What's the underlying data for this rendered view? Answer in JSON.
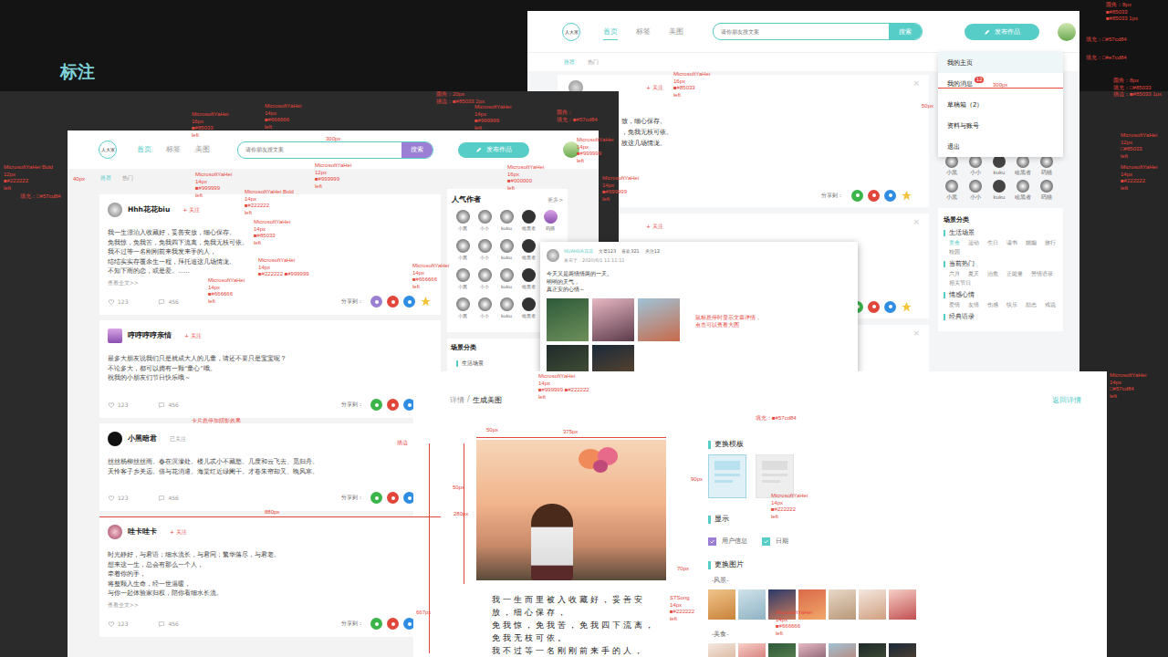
{
  "page_label": "标注",
  "back_window": {
    "logo": "人大家",
    "nav": [
      {
        "label": "首页",
        "selected": true
      },
      {
        "label": "标签",
        "selected": false
      },
      {
        "label": "美图",
        "selected": false
      }
    ],
    "search": {
      "placeholder": "请你朋友搜文案",
      "button": "搜索"
    },
    "publish": "发布作品",
    "subnav": [
      {
        "label": "推荐",
        "selected": true
      },
      {
        "label": "热门",
        "selected": false
      }
    ],
    "posts": [
      {
        "follow": "+ 关注",
        "close": "×",
        "lines": [
          "致，细心保存。",
          "，免我无枝可依。",
          "故这几场情泷。"
        ],
        "share_label": "分享到："
      },
      {
        "follow": "+ 关注",
        "close": "×"
      },
      {
        "close": "×"
      }
    ],
    "menu": [
      {
        "label": "我的主页",
        "selected": true
      },
      {
        "label": "我的消息",
        "badge": "12",
        "selected": false
      },
      {
        "label": "草稿箱（2）",
        "selected": false
      },
      {
        "label": "资料与账号",
        "selected": false
      },
      {
        "label": "退出",
        "selected": false
      }
    ],
    "authors": [
      "小黑",
      "小小",
      "kuku",
      "啥黑者",
      "码猫",
      "小黑",
      "小小",
      "kuku",
      "啥黑者",
      "码猫"
    ],
    "scenes": {
      "title": "场景分类",
      "groups": [
        {
          "name": "生活场景",
          "tags": [
            "美食",
            "运动",
            "生日",
            "读书",
            "婚姻",
            "旅行",
            "校园"
          ]
        },
        {
          "name": "当前热门",
          "tags": [
            "六月",
            "夏天",
            "治愈",
            "正能量",
            "苦情语录",
            "相关节日"
          ]
        },
        {
          "name": "情感心情",
          "tags": [
            "爱情",
            "友情",
            "伤感",
            "快乐",
            "励志",
            "戏说"
          ]
        },
        {
          "name": "经典语录",
          "tags": []
        }
      ]
    }
  },
  "feed_window": {
    "logo": "人大家",
    "nav": [
      {
        "label": "首页",
        "selected": true
      },
      {
        "label": "标签",
        "selected": false
      },
      {
        "label": "美图",
        "selected": false
      }
    ],
    "search": {
      "placeholder": "请你朋友搜文案",
      "button": "搜索"
    },
    "publish": "发布作品",
    "subnav": [
      {
        "label": "推荐",
        "selected": true
      },
      {
        "label": "热门",
        "selected": false
      }
    ],
    "posts": [
      {
        "author": "Hhh花花biu",
        "follow": "+ 关注",
        "followed": false,
        "lines": [
          "我一生漂泊入收藏好，妥善安放，细心保存。",
          "免我惊，免我苦，免我四下流离，免我无枝可依。",
          "我不过等一名刚刚前来我发来手的人，",
          "结结实实存覆余生一程，拜托追这几场情泷。",
          "不知下雨的恋，或是爱。……"
        ],
        "more": "查看全文>>",
        "likes": "123",
        "comments": "456",
        "share_label": "分享到："
      },
      {
        "author": "哼哼哼哼亲情",
        "follow": "+ 关注",
        "followed": false,
        "lines": [
          "最多大朋友说我们只是就成大人的儿童，请还不要只是宝宝呢？",
          "不论多大，都可以拥有一颗“童心”哦。",
          "祝我的小朋友们节日快乐哦～"
        ],
        "likes": "123",
        "comments": "456",
        "share_label": "分享到："
      },
      {
        "author": "小黑暗君",
        "follow": "已关注",
        "followed": true,
        "lines": [
          "丝丝杨柳丝丝雨。春在溟濛处。楼儿忒小不藏愁。几度和云飞去、觅归舟。",
          "天怜客子乡关远。借与花消遣。海棠红近绿阑干。才卷朱帘却又、晚风寒。"
        ],
        "likes": "123",
        "comments": "456",
        "share_label": "分享到："
      },
      {
        "author": "哇卡哇卡",
        "follow": "+ 关注",
        "followed": false,
        "lines": [
          "时光静好，与君语；细水流长，与君同；繁华落尽，与君老。",
          "想来这一生，总会有那么一个人，",
          "牵着你的手，",
          "将整颗入生命，经一世温暖，",
          "与你一起体验家归权，陪你看细水长流。"
        ],
        "more": "查看全文>>",
        "likes": "123",
        "comments": "456",
        "share_label": "分享到："
      }
    ],
    "authors_title": "人气作者",
    "authors_more": "更多>",
    "author_rows": [
      [
        "小黑",
        "小小",
        "kuku",
        "啥黑者",
        "码猫"
      ],
      [
        "小黑",
        "小小",
        "kuku",
        "啥黑者"
      ],
      [
        "小黑",
        "小小",
        "kuku",
        "啥黑者"
      ],
      [
        "小黑",
        "小小",
        "kuku",
        "啥黑者"
      ]
    ],
    "scenes_title": "场景分类",
    "scene_first": "生活场景"
  },
  "popup": {
    "author": "HUAHUA花花",
    "stats": [
      "文章123",
      "喜欢321",
      "关注12"
    ],
    "date": "发布于：2020/6/1 11:11:11",
    "lines": [
      "今天又是两情情两的一天。",
      "明明的天气，",
      "真正安的心情～"
    ]
  },
  "detail_window": {
    "crumb": [
      {
        "label": "详情",
        "selected": false
      },
      {
        "label": "生成美图",
        "selected": true
      }
    ],
    "separator": "/",
    "back": "返回详情",
    "poem": [
      "我一生而里被入收藏好，妥善安",
      "放，细心保存，",
      "免我惊，免我苦，免我四下流离，",
      "免我无枝可依。",
      "我不过等一名刚刚前来手的人，"
    ],
    "template_title": "更换模板",
    "templates": [
      {
        "selected": true
      },
      {
        "selected": false
      }
    ],
    "show_title": "显示",
    "options": [
      {
        "label": "用户信息",
        "checked": true,
        "color": "#9b7fd4"
      },
      {
        "label": "日期",
        "checked": true,
        "color": "#57cdc8"
      }
    ],
    "image_title": "更换图片",
    "image_groups": [
      {
        "name": "-风景-"
      },
      {
        "name": "-美食-"
      }
    ]
  },
  "annotations": [
    {
      "lines": [
        "MicrosoftYaHei Bold",
        "12px",
        "■#222222",
        "left"
      ]
    },
    {
      "lines": [
        "填充：□#57cd84"
      ]
    },
    {
      "lines": [
        "MicrosoftYaHei",
        "16px",
        "■#85033",
        "left"
      ]
    },
    {
      "lines": [
        "MicrosoftYaHei",
        "14px",
        "■#666666",
        "left"
      ]
    },
    {
      "lines": [
        "圆角：20px",
        "描边：■#85033 2px"
      ]
    },
    {
      "lines": [
        "MicrosoftYaHei",
        "14px",
        "■#999999",
        "left"
      ]
    },
    {
      "lines": [
        "圆角：",
        "填充：■#57cd84"
      ]
    },
    {
      "lines": [
        "MicrosoftYaHei",
        "14px",
        "■#999999",
        "left"
      ]
    },
    {
      "lines": [
        "MicrosoftYaHei",
        "12px",
        "■#999999",
        "left"
      ]
    },
    {
      "lines": [
        "MicrosoftYaHei",
        "14px",
        "■#999999",
        "left"
      ]
    },
    {
      "lines": [
        "MicrosoftYaHei Bold",
        "14px",
        "■#222222",
        "left"
      ]
    },
    {
      "lines": [
        "MicrosoftYaHei",
        "14px",
        "■#85033",
        "left"
      ]
    },
    {
      "lines": [
        "MicrosoftYaHei",
        "14px",
        "■#222222 ■#999999"
      ]
    },
    {
      "lines": [
        "MicrosoftYaHei",
        "14px",
        "■#666666",
        "left"
      ]
    },
    {
      "lines": [
        "MicrosoftYaHei",
        "14px",
        "■#666666",
        "left"
      ]
    },
    {
      "lines": [
        "MicrosoftYaHei",
        "16px",
        "■#000000",
        "left"
      ]
    },
    {
      "lines": [
        "MicrosoftYaHei",
        "14px",
        "■#999999",
        "left"
      ]
    },
    {
      "lines": [
        "卡片悬停加阴影效果"
      ]
    },
    {
      "lines": [
        "描边"
      ]
    },
    {
      "lines": [
        "鼠标悬停时显示文章详情，",
        "点击可以查看大图"
      ]
    },
    {
      "lines": [
        "MicrosoftYaHei",
        "16px",
        "■#85033",
        "left"
      ]
    },
    {
      "lines": [
        "圆角：8px",
        "■#85033",
        "■#85033 1px"
      ]
    },
    {
      "lines": [
        "填充：□#57cd84"
      ]
    },
    {
      "lines": [
        "填充：□#e7cd84"
      ]
    },
    {
      "lines": [
        "圆角：8px",
        "填充：□#85033",
        "描边：■#85033 1px"
      ]
    },
    {
      "lines": [
        "MicrosoftYaHei",
        "12px",
        "□#85033",
        "left"
      ]
    },
    {
      "lines": [
        "MicrosoftYaHei",
        "14px",
        "■#222222",
        "left"
      ]
    },
    {
      "lines": [
        "MicrosoftYaHei",
        "14px",
        "□#57cd84",
        "left"
      ]
    },
    {
      "lines": [
        "MicrosoftYaHei",
        "14px",
        "■#999999 ■#222222",
        "left"
      ]
    },
    {
      "lines": [
        "填充：■#57cd84"
      ]
    },
    {
      "lines": [
        "MicrosoftYaHei",
        "14px",
        "■#222222",
        "left"
      ]
    },
    {
      "lines": [
        "STSong",
        "14px",
        "■#222222",
        "left"
      ]
    },
    {
      "lines": [
        "MicrosoftYaHei",
        "14px",
        "■#666666",
        "left"
      ]
    },
    {
      "lines": [
        "300px"
      ]
    },
    {
      "lines": [
        "880px"
      ]
    },
    {
      "lines": [
        "375px"
      ]
    },
    {
      "lines": [
        "50px"
      ]
    },
    {
      "lines": [
        "280px"
      ]
    },
    {
      "lines": [
        "667px"
      ]
    },
    {
      "lines": [
        "90px"
      ]
    },
    {
      "lines": [
        "70px"
      ]
    },
    {
      "lines": [
        "50px"
      ]
    },
    {
      "lines": [
        "40px"
      ]
    },
    {
      "lines": [
        "300px"
      ]
    },
    {
      "lines": [
        "50px"
      ]
    }
  ]
}
